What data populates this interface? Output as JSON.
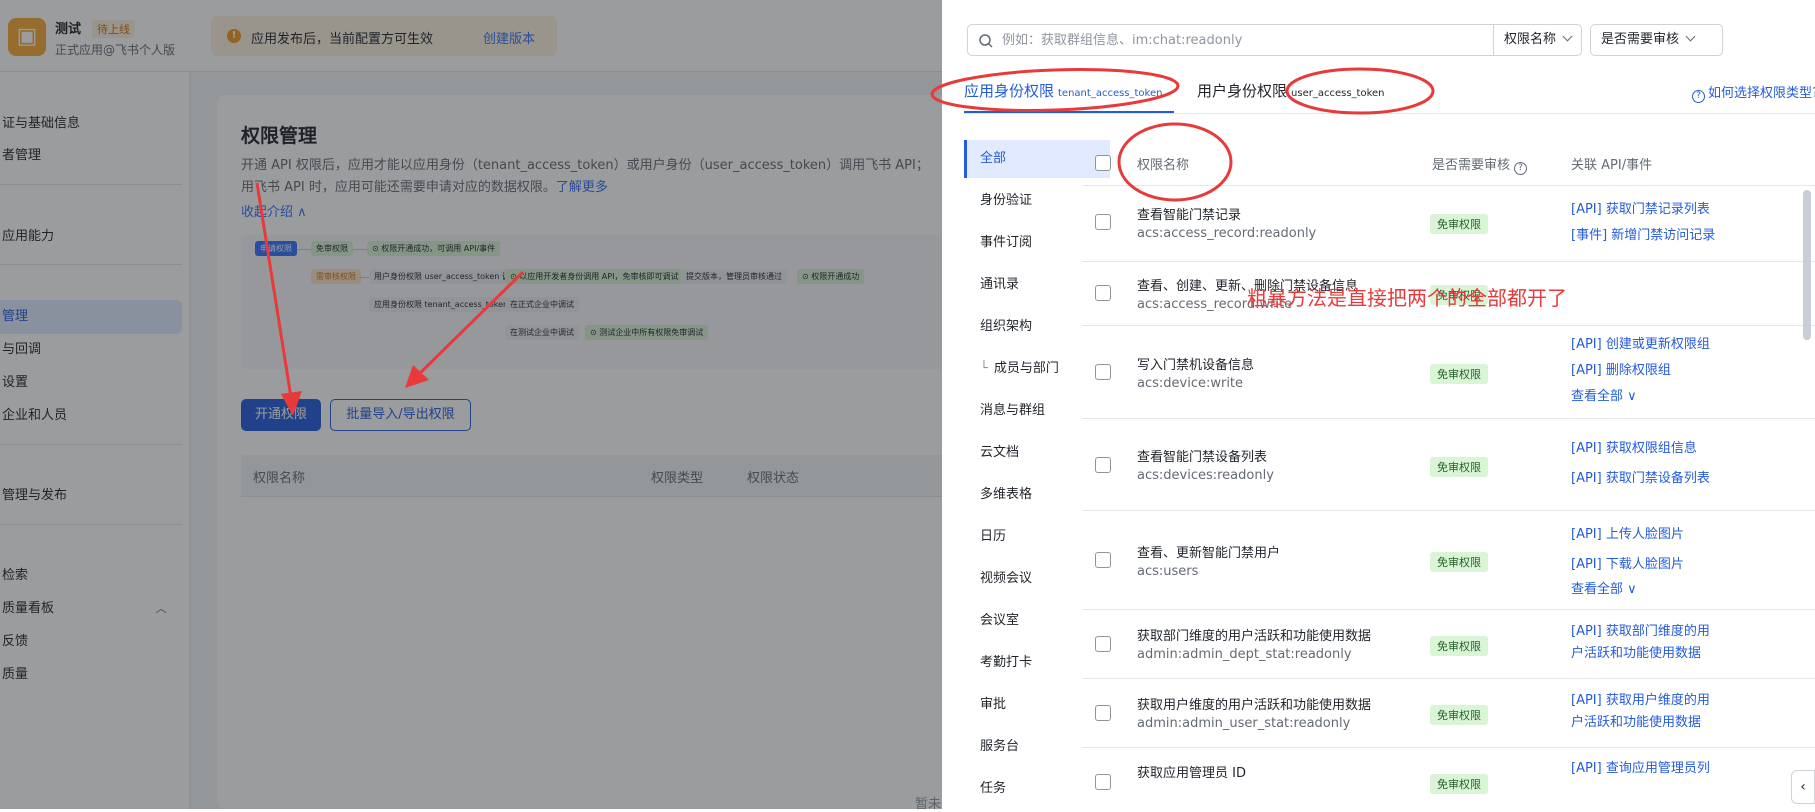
{
  "app": {
    "logo_glyph": "▣",
    "name": "测试",
    "status_badge": "待上线",
    "subtitle": "正式应用@飞书个人版"
  },
  "notice": {
    "icon_glyph": "!",
    "text": "应用发布后，当前配置方可生效",
    "link": "创建版本"
  },
  "sidebar": {
    "items": [
      {
        "label": "证与基础信息"
      },
      {
        "label": "者管理"
      },
      {
        "label": "应用能力"
      },
      {
        "label": "管理"
      },
      {
        "label": "与回调"
      },
      {
        "label": "设置"
      },
      {
        "label": "企业和人员"
      },
      {
        "label": "管理与发布"
      },
      {
        "label": "检索"
      },
      {
        "label": "质量看板"
      },
      {
        "label": "反馈"
      },
      {
        "label": "质量"
      }
    ],
    "group_labels": [
      "",
      "",
      "",
      "",
      ""
    ],
    "collapse_glyph": "︿"
  },
  "main": {
    "title": "权限管理",
    "description_1": "开通 API 权限后，应用才能以应用身份（tenant_access_token）或用户身份（user_access_token）调用飞书 API；",
    "description_2": "用飞书 API 时，应用可能还需要申请对应的数据权限。",
    "learn_more": "了解更多",
    "collapse_intro": "收起介绍 ∧",
    "flow": {
      "apply": "申请权限",
      "no_review": "免审权限",
      "no_review_result": "⊙ 权限开通成功，可调用 API/事件",
      "need_review": "需审核权限",
      "user_identity": "用户身份权限",
      "user_token": "user_access_token 调用",
      "dev_result": "⊙ 以应用开发者身份调用 API，免审核即可调试",
      "submit": "提交版本，管理员审核通过",
      "open_result": "⊙ 权限开通成功",
      "app_identity": "应用身份权限",
      "tenant_token": "tenant_access_token 调用",
      "prod_test": "在正式企业中调试",
      "test_tenant": "在测试企业中调试",
      "test_result": "⊙ 测试企业中所有权限免审调试"
    },
    "btn_enable": "开通权限",
    "btn_batch": "批量导入/导出权限",
    "table_cols": {
      "name": "权限名称",
      "type": "权限类型",
      "status": "权限状态"
    },
    "empty_text": "暂未"
  },
  "panel": {
    "search_placeholder": "例如：获取群组信息、im:chat:readonly",
    "filter_name": "权限名称",
    "filter_review": "是否需要审核",
    "tabs": [
      {
        "label": "应用身份权限",
        "token": "tenant_access_token"
      },
      {
        "label": "用户身份权限",
        "token": "user_access_token"
      }
    ],
    "help_glyph": "?",
    "help_link": "如何选择权限类型?",
    "categories": [
      {
        "label": "全部"
      },
      {
        "label": "身份验证"
      },
      {
        "label": "事件订阅"
      },
      {
        "label": "通讯录"
      },
      {
        "label": "组织架构"
      },
      {
        "label": "成员与部门"
      },
      {
        "label": "消息与群组"
      },
      {
        "label": "云文档"
      },
      {
        "label": "多维表格"
      },
      {
        "label": "日历"
      },
      {
        "label": "视频会议"
      },
      {
        "label": "会议室"
      },
      {
        "label": "考勤打卡"
      },
      {
        "label": "审批"
      },
      {
        "label": "服务台"
      },
      {
        "label": "任务"
      }
    ],
    "tree_glyph": "└",
    "table_head": {
      "name": "权限名称",
      "review": "是否需要审核",
      "review_help": "?",
      "related": "关联 API/事件"
    },
    "rows": [
      {
        "name": "查看智能门禁记录",
        "scope": "acs:access_record:readonly",
        "badge": "免审权限",
        "apis": [
          "[API] 获取门禁记录列表",
          "[事件] 新增门禁访问记录"
        ]
      },
      {
        "name": "查看、创建、更新、删除门禁设备信息",
        "scope": "acs:access_record:write",
        "badge": "免审权限",
        "apis": []
      },
      {
        "name": "写入门禁机设备信息",
        "scope": "acs:device:write",
        "badge": "免审权限",
        "apis": [
          "[API] 创建或更新权限组",
          "[API] 删除权限组",
          "查看全部 ∨"
        ]
      },
      {
        "name": "查看智能门禁设备列表",
        "scope": "acs:devices:readonly",
        "badge": "免审权限",
        "apis": [
          "[API] 获取权限组信息",
          "[API] 获取门禁设备列表"
        ]
      },
      {
        "name": "查看、更新智能门禁用户",
        "scope": "acs:users",
        "badge": "免审权限",
        "apis": [
          "[API] 上传人脸图片",
          "[API] 下载人脸图片",
          "查看全部 ∨"
        ]
      },
      {
        "name": "获取部门维度的用户活跃和功能使用数据",
        "scope": "admin:admin_dept_stat:readonly",
        "badge": "免审权限",
        "apis": [
          "[API] 获取部门维度的用",
          "户活跃和功能使用数据"
        ]
      },
      {
        "name": "获取用户维度的用户活跃和功能使用数据",
        "scope": "admin:admin_user_stat:readonly",
        "badge": "免审权限",
        "apis": [
          "[API] 获取用户维度的用",
          "户活跃和功能使用数据"
        ]
      },
      {
        "name": "获取应用管理员 ID",
        "scope": "",
        "badge": "免审权限",
        "apis": [
          "[API] 查询应用管理员列"
        ]
      }
    ],
    "float_glyph": "‹"
  },
  "annotation": {
    "text": "粗暴方法是直接把两个的全部都开了",
    "color": "#e83a3a"
  },
  "colors": {
    "accent": "#245bdb",
    "badge_bg": "#d9f5d6",
    "overlay": "rgba(31,35,41,0.45)"
  }
}
